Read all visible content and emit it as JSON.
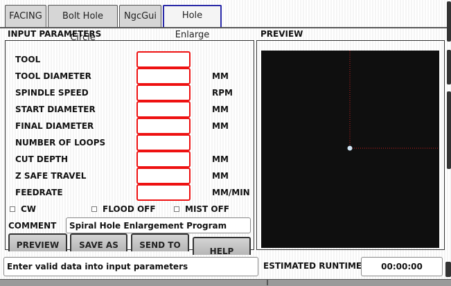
{
  "tabs": [
    {
      "label": "FACING"
    },
    {
      "label": "Bolt Hole Circle"
    },
    {
      "label": "NgcGui"
    },
    {
      "label": "Hole Enlarge"
    }
  ],
  "input_panel": {
    "title": "INPUT PARAMETERS",
    "fields": [
      {
        "label": "TOOL",
        "unit": "",
        "value": ""
      },
      {
        "label": "TOOL DIAMETER",
        "unit": "MM",
        "value": ""
      },
      {
        "label": "SPINDLE SPEED",
        "unit": "RPM",
        "value": ""
      },
      {
        "label": "START DIAMETER",
        "unit": "MM",
        "value": ""
      },
      {
        "label": "FINAL DIAMETER",
        "unit": "MM",
        "value": ""
      },
      {
        "label": "NUMBER OF LOOPS",
        "unit": "",
        "value": ""
      },
      {
        "label": "CUT DEPTH",
        "unit": "MM",
        "value": ""
      },
      {
        "label": "Z SAFE TRAVEL",
        "unit": "MM",
        "value": ""
      },
      {
        "label": "FEEDRATE",
        "unit": "MM/MIN",
        "value": ""
      }
    ],
    "checkboxes": [
      {
        "label": "CW"
      },
      {
        "label": "FLOOD OFF"
      },
      {
        "label": "MIST OFF"
      }
    ],
    "comment_label": "COMMENT",
    "comment_value": "Spiral Hole Enlargement Program",
    "buttons": [
      {
        "label": "PREVIEW"
      },
      {
        "label": "SAVE AS"
      },
      {
        "label": "SEND TO"
      },
      {
        "label": "HELP"
      }
    ]
  },
  "preview_panel": {
    "title": "PREVIEW",
    "canvas_bg": "#0f0f0f",
    "axis_color": "#cc2222",
    "origin_color": "#cfe4f3"
  },
  "status": {
    "message": "Enter valid data into input parameters",
    "runtime_label": "ESTIMATED RUNTIME",
    "runtime_value": "00:00:00"
  }
}
